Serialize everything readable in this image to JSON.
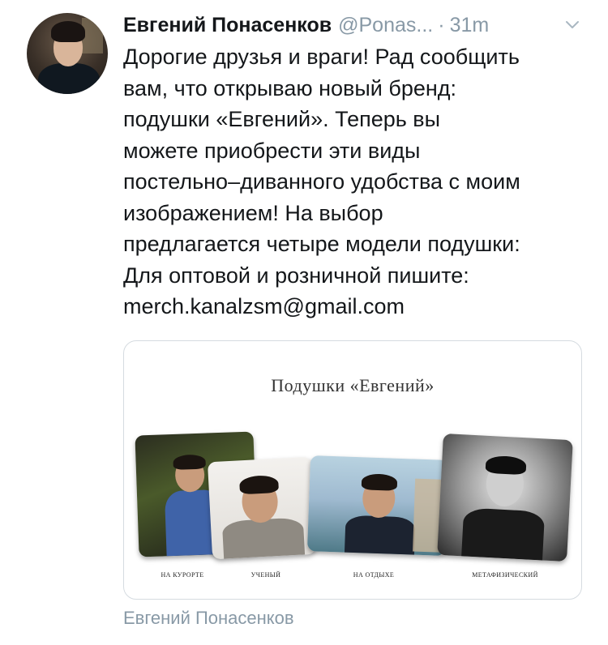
{
  "tweet": {
    "author_name": "Евгений Понасенков",
    "handle": "@Ponas...",
    "separator": "·",
    "time": "31m",
    "text_lines": [
      "Дорогие друзья и враги! Рад сообщить",
      "вам, что открываю новый бренд:",
      "подушки «Евгений». Теперь вы",
      "можете приобрести эти виды",
      "постельно–диванного удобства с моим",
      "изображением! На выбор",
      "предлагается четыре модели подушки:",
      "Для оптовой и розничной пишите:",
      "merch.kanalzsm@gmail.com"
    ]
  },
  "media": {
    "title": "Подушки «Евгений»",
    "labels": [
      "НА КУРОРТЕ",
      "УЧЕНЫЙ",
      "НА ОТДЫХЕ",
      "МЕТАФИЗИЧЕСКИЙ"
    ]
  },
  "footer": {
    "quoted_name": "Евгений Понасенков"
  },
  "icons": {
    "menu": "chevron-down-icon"
  },
  "colors": {
    "text": "#14171a",
    "secondary": "#8899a6",
    "border": "#d5dbe0"
  }
}
